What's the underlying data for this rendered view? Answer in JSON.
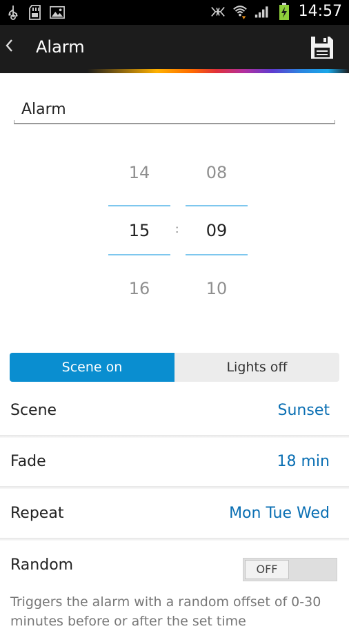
{
  "status_bar": {
    "time": "14:57",
    "left_icons": [
      "usb-icon",
      "sd-card-icon",
      "image-icon"
    ],
    "right_icons": [
      "nfc-icon",
      "wifi-icon",
      "signal-icon",
      "battery-charging-icon"
    ]
  },
  "app_bar": {
    "title": "Alarm",
    "back_icon": "chevron-left-icon",
    "save_icon": "save-icon"
  },
  "name_field": {
    "value": "Alarm"
  },
  "time_picker": {
    "hours": {
      "prev": "14",
      "current": "15",
      "next": "16"
    },
    "minutes": {
      "prev": "08",
      "current": "09",
      "next": "10"
    },
    "separator": ":"
  },
  "segment": {
    "options": [
      {
        "label": "Scene on",
        "selected": true
      },
      {
        "label": "Lights off",
        "selected": false
      }
    ]
  },
  "settings": {
    "scene": {
      "label": "Scene",
      "value": "Sunset"
    },
    "fade": {
      "label": "Fade",
      "value": "18 min"
    },
    "repeat": {
      "label": "Repeat",
      "value": "Mon Tue Wed"
    },
    "random": {
      "label": "Random",
      "toggle": "OFF"
    }
  },
  "help_text": "Triggers the alarm with a random offset of 0-30 minutes before or after the set time",
  "colors": {
    "accent": "#0a8ed0",
    "value_text": "#0a6fb3",
    "app_bar": "#1c1c1c"
  }
}
